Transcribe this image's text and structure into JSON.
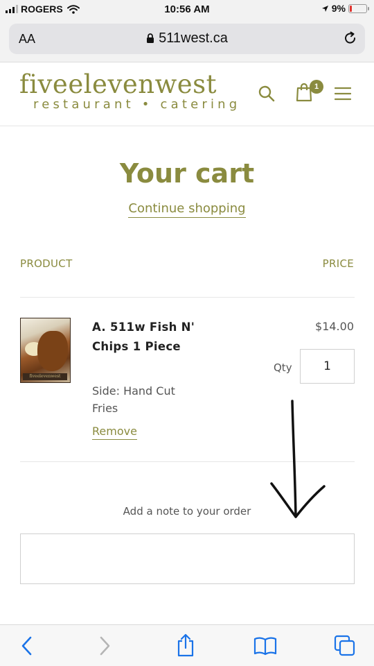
{
  "status_bar": {
    "carrier": "ROGERS",
    "time": "10:56 AM",
    "battery": "9%"
  },
  "browser": {
    "text_size_label": "AA",
    "url": "511west.ca"
  },
  "site": {
    "logo_main": "fiveelevenwest",
    "logo_sub": "restaurant • catering",
    "cart_count": "1"
  },
  "cart": {
    "title": "Your cart",
    "continue_label": "Continue shopping",
    "col_product": "PRODUCT",
    "col_price": "PRICE",
    "item": {
      "name": "A. 511w Fish N' Chips 1 Piece",
      "side": "Side: Hand Cut Fries",
      "price": "$14.00",
      "qty_label": "Qty",
      "qty": "1",
      "remove_label": "Remove",
      "image_label": "fiveelevenwest"
    },
    "note_label": "Add a note to your order"
  },
  "colors": {
    "accent": "#8a8b3f",
    "ios_blue": "#1a73e8"
  }
}
